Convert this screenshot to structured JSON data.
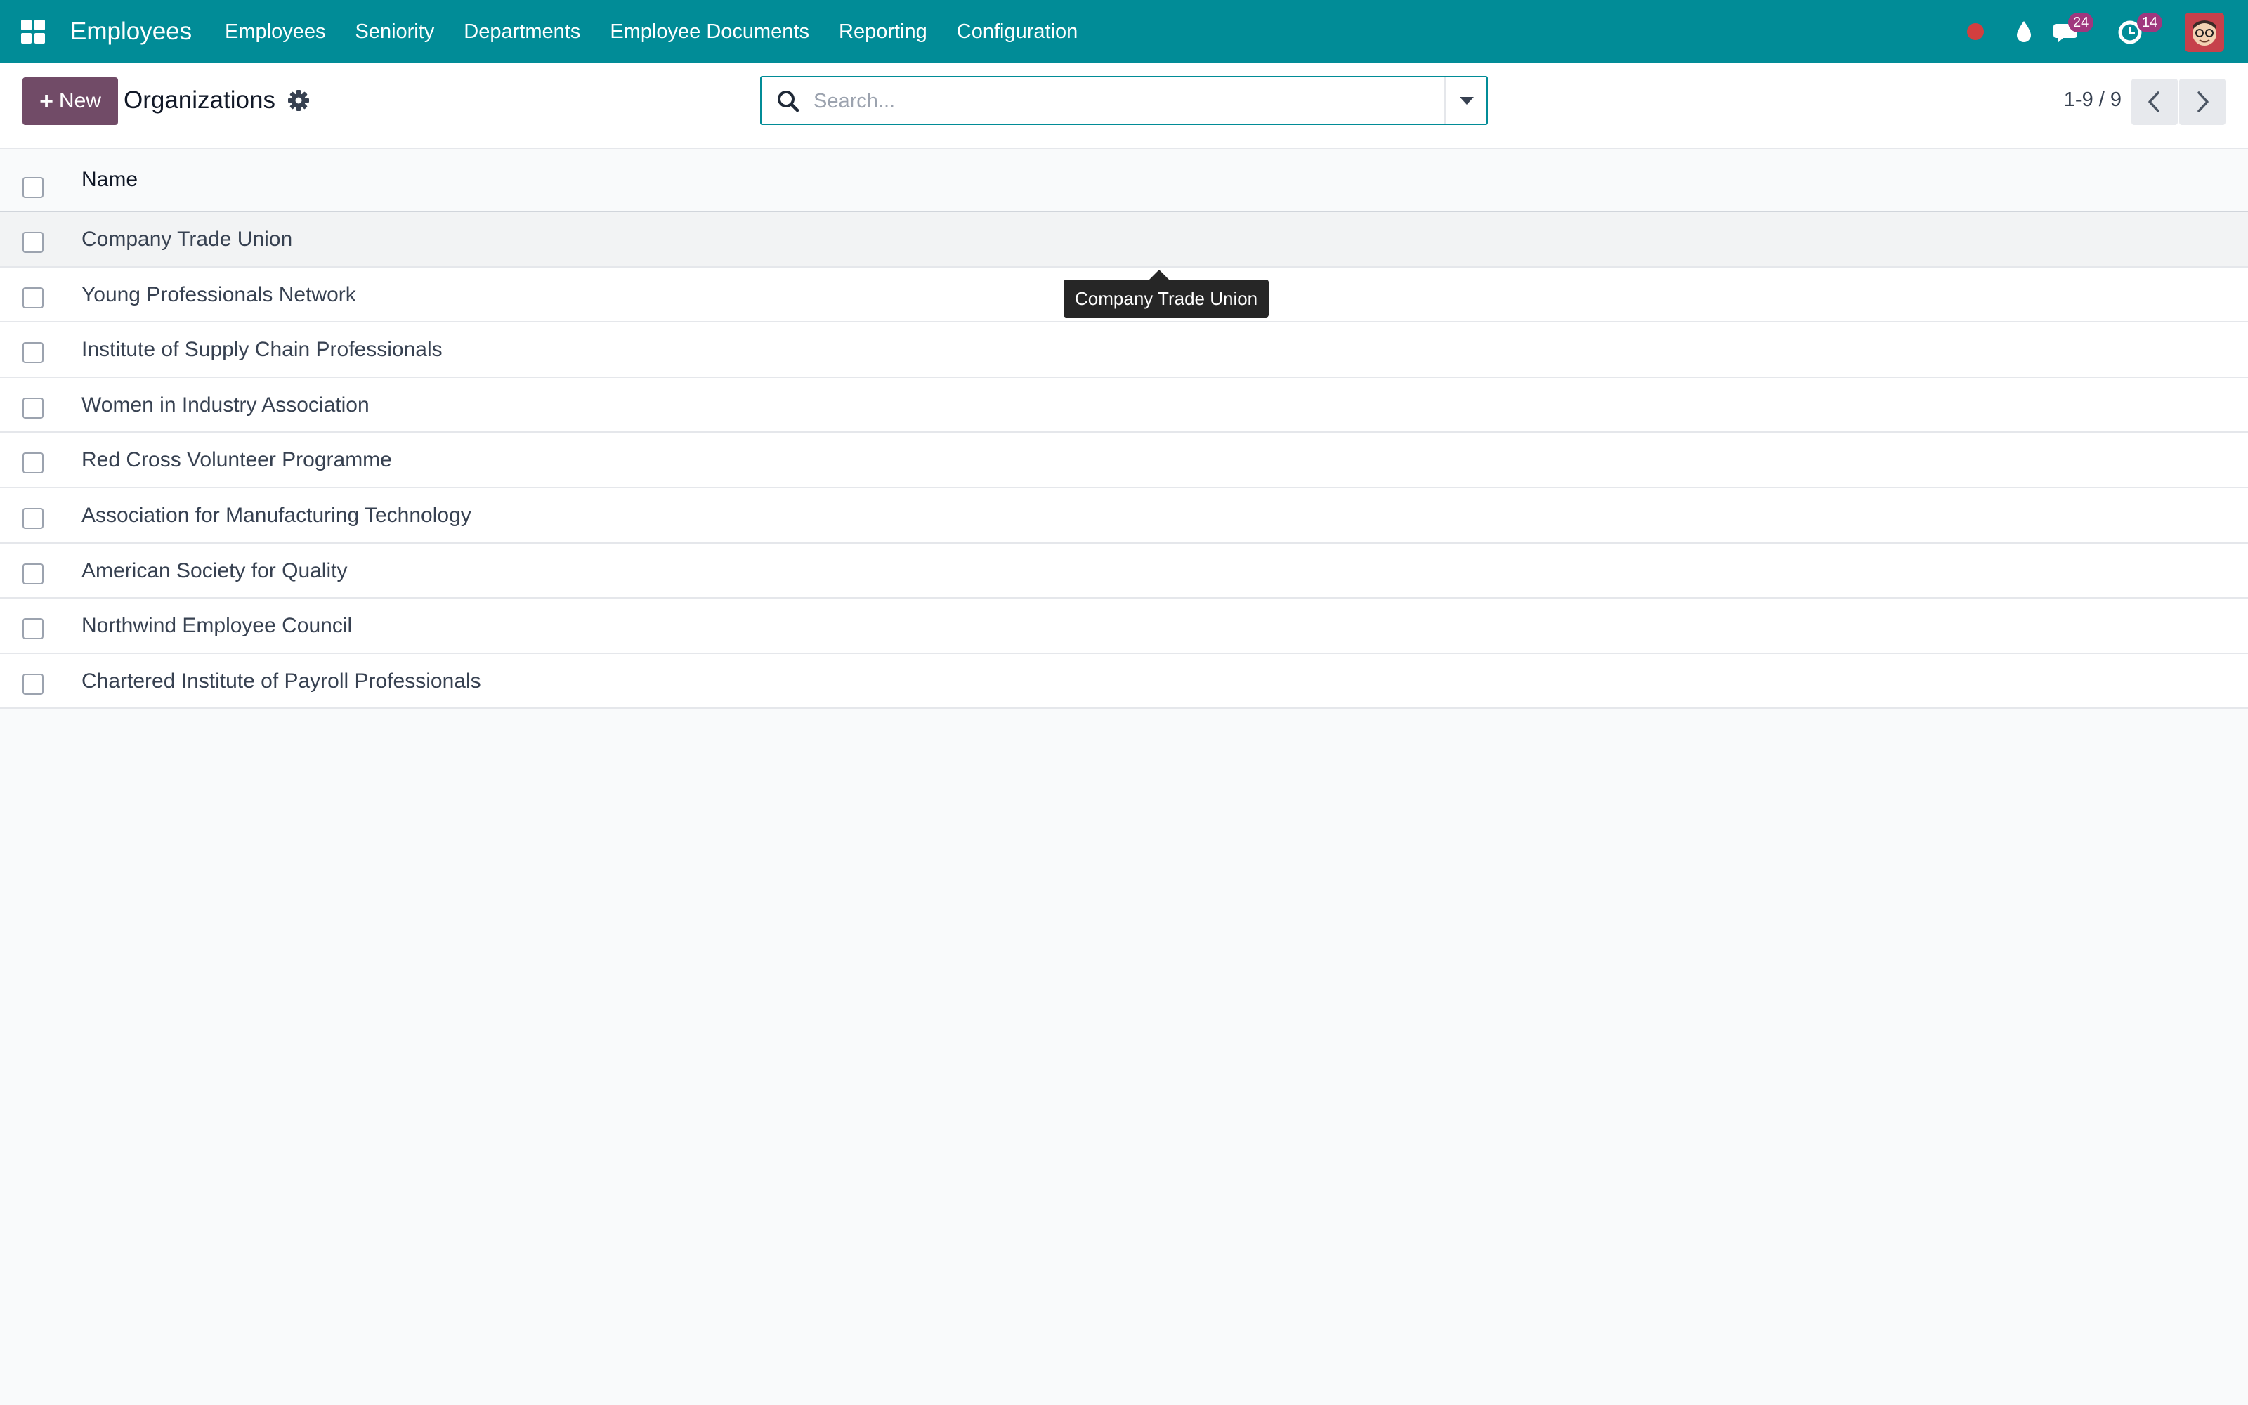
{
  "navbar": {
    "brand": "Employees",
    "menu": [
      "Employees",
      "Seniority",
      "Departments",
      "Employee Documents",
      "Reporting",
      "Configuration"
    ],
    "messages_badge": "24",
    "activities_badge": "14",
    "accent_color": "#018c97"
  },
  "control_panel": {
    "new_label": "New",
    "title": "Organizations",
    "search_placeholder": "Search...",
    "pager": "1-9 / 9"
  },
  "list": {
    "column_name": "Name",
    "rows": [
      "Company Trade Union",
      "Young Professionals Network",
      "Institute of Supply Chain Professionals",
      "Women in Industry Association",
      "Red Cross Volunteer Programme",
      "Association for Manufacturing Technology",
      "American Society for Quality",
      "Northwind Employee Council",
      "Chartered Institute of Payroll Professionals"
    ]
  },
  "tooltip": "Company Trade Union"
}
